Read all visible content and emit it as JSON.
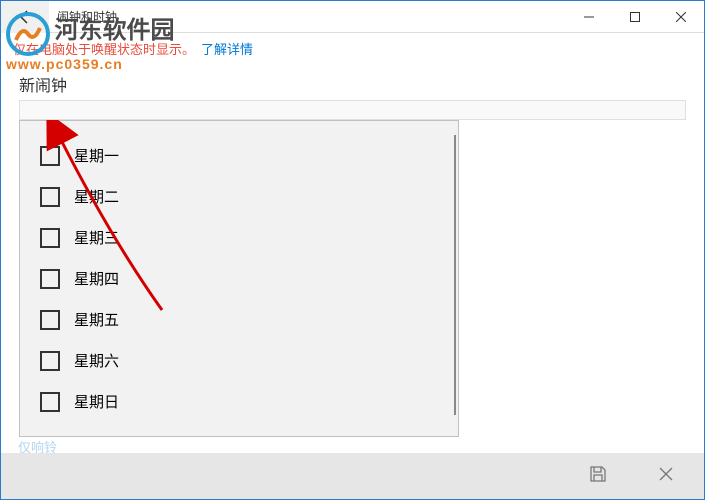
{
  "titlebar": {
    "title": "闹钟和时钟"
  },
  "notification": {
    "text": "仅在电脑处于唤醒状态时显示。",
    "link": "了解详情"
  },
  "watermark": {
    "text": "河东软件园",
    "url": "www.pc0359.cn"
  },
  "page": {
    "subtitle": "新闹钟"
  },
  "days": [
    {
      "label": "星期一",
      "checked": false
    },
    {
      "label": "星期二",
      "checked": false
    },
    {
      "label": "星期三",
      "checked": false
    },
    {
      "label": "星期四",
      "checked": false
    },
    {
      "label": "星期五",
      "checked": false
    },
    {
      "label": "星期六",
      "checked": false
    },
    {
      "label": "星期日",
      "checked": false
    }
  ],
  "footer": {
    "partial_link": "仅响铃"
  },
  "icons": {
    "back": "←",
    "minimize": "—",
    "maximize": "☐",
    "close": "✕",
    "save": "💾",
    "cancel": "✕"
  }
}
